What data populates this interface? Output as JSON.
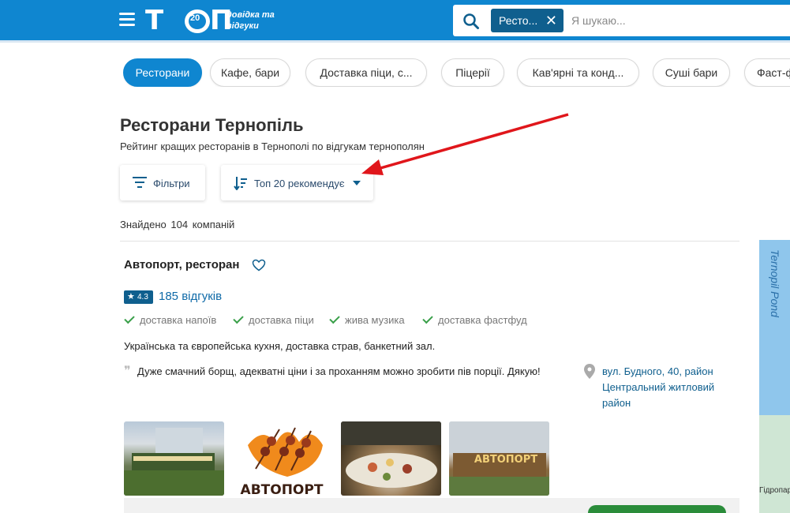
{
  "header": {
    "logo_text": "Т",
    "logo_text2": "П",
    "logo_badge": "20",
    "logo_subtitle_line1": "довідка та",
    "logo_subtitle_line2": "відгуки",
    "search_chip": "Ресто...",
    "search_placeholder": "Я шукаю..."
  },
  "categories": [
    {
      "label": "Ресторани",
      "active": true
    },
    {
      "label": "Кафе, бари",
      "active": false
    },
    {
      "label": "Доставка піци, с...",
      "active": false
    },
    {
      "label": "Піцерії",
      "active": false
    },
    {
      "label": "Кав'ярні та конд...",
      "active": false
    },
    {
      "label": "Суші бари",
      "active": false
    },
    {
      "label": "Фаст-ф",
      "active": false
    }
  ],
  "page": {
    "title": "Ресторани Тернопіль",
    "subtitle": "Рейтинг кращих ресторанів в Тернополі по відгукам тернополян"
  },
  "toolbar": {
    "filters_label": "Фільтри",
    "sort_label": "Топ 20 рекомендує"
  },
  "results": {
    "found_label": "Знайдено",
    "count": "104",
    "companies_label": "компаній"
  },
  "listing": {
    "name": "Автопорт, ресторан",
    "rating": "4.3",
    "reviews": "185 відгуків",
    "features": [
      "доставка напоїв",
      "доставка піци",
      "жива музика",
      "доставка фастфуд"
    ],
    "description": "Українська та європейська кухня, доставка страв, банкетний зал.",
    "review_quote": "Дуже смачний борщ, адекватні ціни і за проханням можно зробити пів порції. Дякую!",
    "address": "вул. Будного, 40, район Центральний житловий район",
    "photo2_text": "АВТОПОРТ",
    "photo4_text": "АВТОПОРТ"
  },
  "map": {
    "pond_label": "Ternopil Pond",
    "bottom_label": "Гідропар"
  },
  "colors": {
    "header_blue": "#0f86d0",
    "dark_blue": "#0f5f8e",
    "check_green": "#3aa04a",
    "annotation_red": "#e0161b"
  }
}
